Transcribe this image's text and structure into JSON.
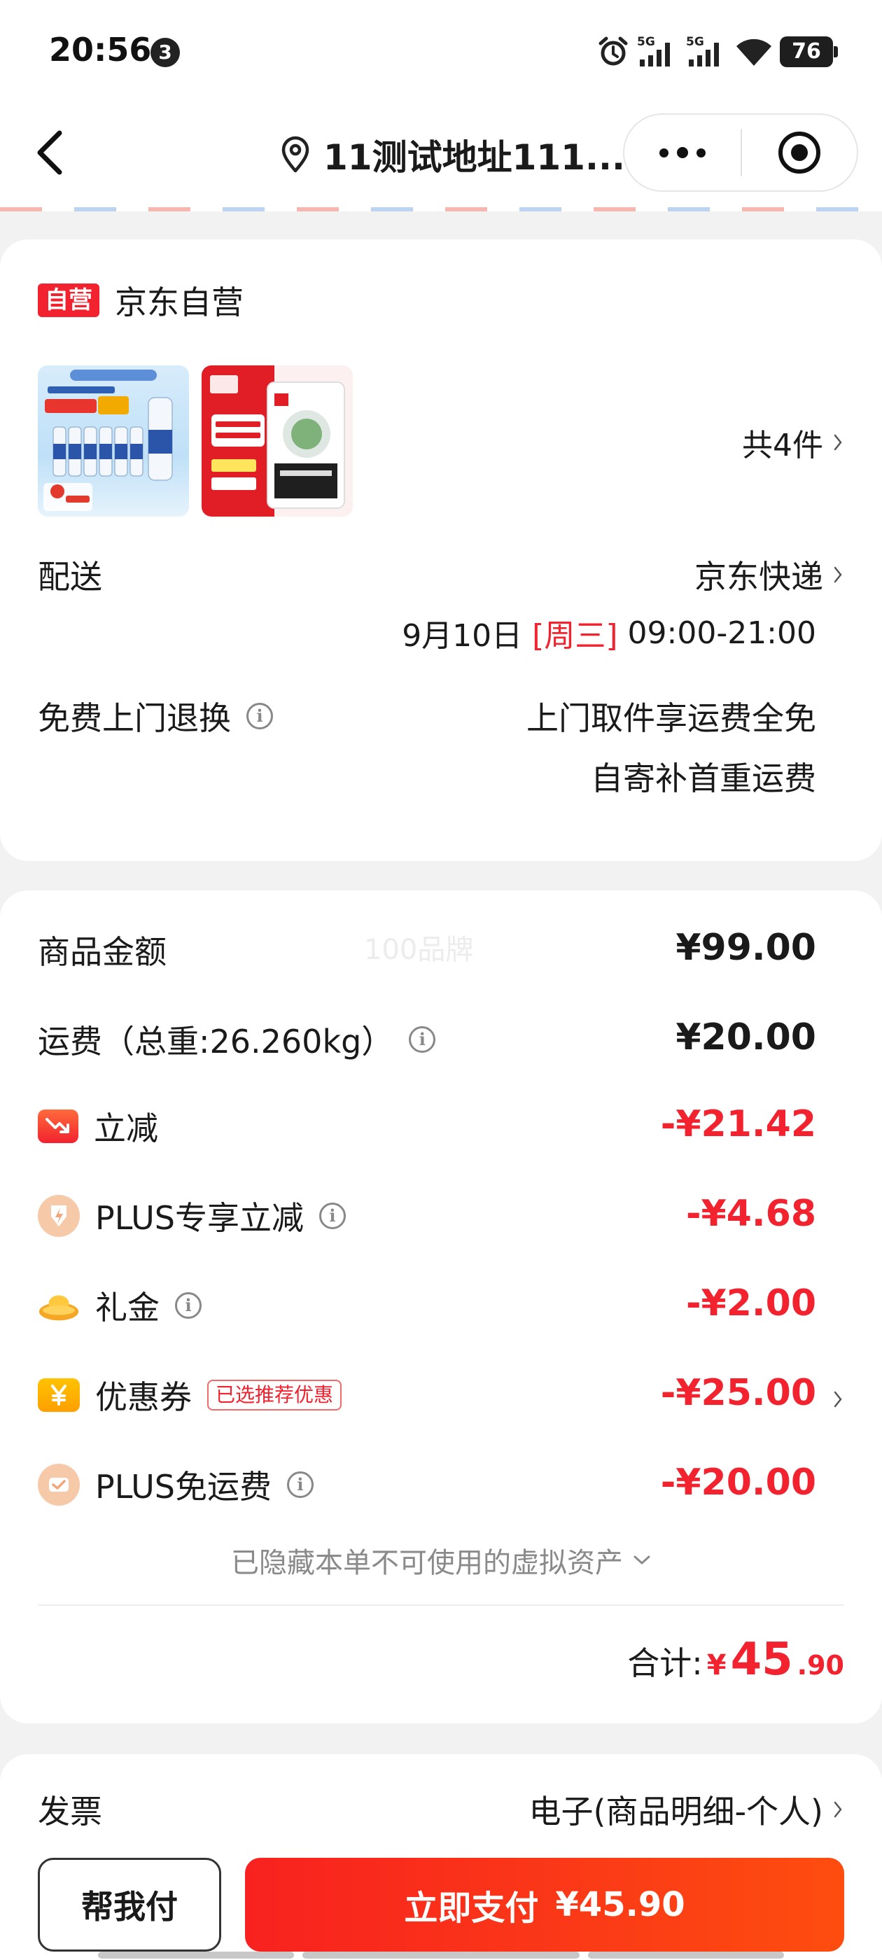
{
  "status_bar": {
    "time": "20:56",
    "notification_count": "3",
    "signal_1": "5G",
    "signal_2": "5G",
    "battery": "76"
  },
  "nav": {
    "address": "11测试地址111..."
  },
  "store": {
    "tag": "自营",
    "name": "京东自营",
    "item_count": "共4件",
    "product_1_icon": "mineral-water-product",
    "product_2_icon": "sea-salt-product"
  },
  "delivery": {
    "label": "配送",
    "carrier": "京东快递",
    "date": "9月10日",
    "weekday": "[周三]",
    "time_window": "09:00-21:00"
  },
  "returns": {
    "label": "免费上门退换",
    "line1": "上门取件享运费全免",
    "line2": "自寄补首重运费"
  },
  "pricing": {
    "watermark": "100品牌",
    "items": [
      {
        "label": "商品金额",
        "value": "¥99.00",
        "color": "#1a1a1a"
      },
      {
        "label": "运费（总重:26.260kg）",
        "value": "¥20.00",
        "color": "#1a1a1a"
      },
      {
        "label": "立减",
        "value": "-¥21.42",
        "color": "#f2222e",
        "icon": "discount-arrow-icon"
      },
      {
        "label": "PLUS专享立减",
        "value": "-¥4.68",
        "color": "#f2222e",
        "icon": "plus-lightning-icon"
      },
      {
        "label": "礼金",
        "value": "-¥2.00",
        "color": "#f2222e",
        "icon": "gold-ingot-icon"
      },
      {
        "label": "优惠券",
        "value": "-¥25.00",
        "color": "#f2222e",
        "icon": "yen-coupon-icon",
        "tag": "已选推荐优惠"
      },
      {
        "label": "PLUS免运费",
        "value": "-¥20.00",
        "color": "#f2222e",
        "icon": "plus-shipping-icon"
      }
    ],
    "hidden_note": "已隐藏本单不可使用的虚拟资产",
    "total_label": "合计:",
    "total_currency": "¥",
    "total_integer": "45",
    "total_decimal": ".90"
  },
  "invoice": {
    "label": "发票",
    "value": "电子(商品明细-个人)"
  },
  "actions": {
    "help_pay": "帮我付",
    "pay_now": "立即支付",
    "pay_amount": "¥45.90"
  },
  "colors": {
    "accent_red": "#f2222e",
    "pay_gradient_start": "#f8211f",
    "pay_gradient_end": "#fe4d0f"
  }
}
